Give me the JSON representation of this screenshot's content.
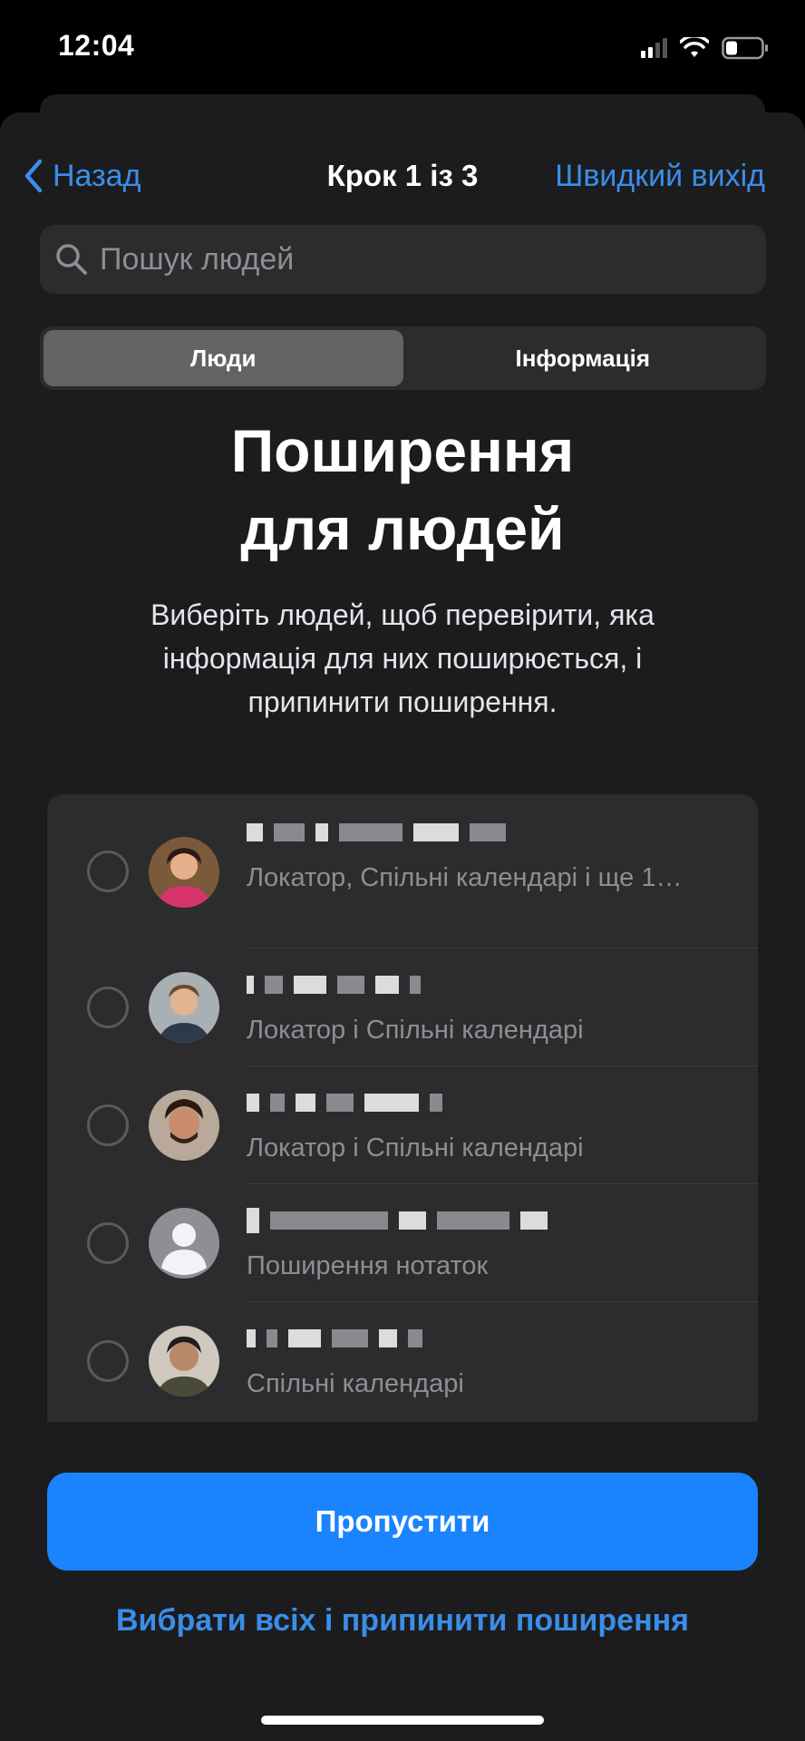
{
  "status_bar": {
    "time": "12:04",
    "icons": [
      "cellular-signal-icon",
      "wifi-icon",
      "battery-icon"
    ]
  },
  "nav": {
    "back_label": "Назад",
    "title": "Крок 1 із 3",
    "quick_exit_label": "Швидкий вихід"
  },
  "search": {
    "placeholder": "Пошук людей",
    "value": ""
  },
  "segments": {
    "items": [
      {
        "label": "Люди",
        "selected": true
      },
      {
        "label": "Інформація",
        "selected": false
      }
    ]
  },
  "header": {
    "title_line1": "Поширення",
    "title_line2": "для людей",
    "subtitle": "Виберіть людей, щоб перевірити, яка інформація для них поширюється, і припинити поширення."
  },
  "people": [
    {
      "avatar": "photo-avatar",
      "detail": "Локатор, Спільні календарі і ще 1…",
      "selected": false
    },
    {
      "avatar": "photo-avatar",
      "detail": "Локатор і Спільні календарі",
      "selected": false
    },
    {
      "avatar": "photo-avatar",
      "detail": "Локатор і Спільні календарі",
      "selected": false
    },
    {
      "avatar": "placeholder-person-avatar",
      "detail": "Поширення нотаток",
      "selected": false
    },
    {
      "avatar": "photo-avatar",
      "detail": "Спільні календарі",
      "selected": false
    }
  ],
  "footer": {
    "skip_label": "Пропустити",
    "select_all_label": "Вибрати всіх і припинити поширення"
  },
  "colors": {
    "accent": "#3a8ee9",
    "primary_button": "#1a84ff",
    "sheet_background": "#1c1c1e",
    "cell_background": "#2c2c2e"
  }
}
